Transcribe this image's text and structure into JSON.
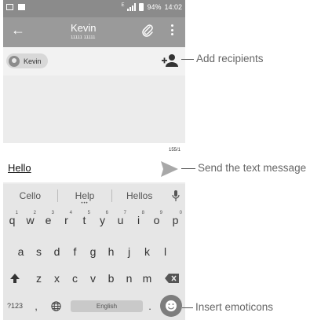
{
  "status_bar": {
    "battery": "94%",
    "time": "14:02",
    "network": "E"
  },
  "app_bar": {
    "contact_name": "Kevin",
    "contact_number": "11111 11111"
  },
  "recipients": {
    "chip_label": "Kevin"
  },
  "compose": {
    "text": "Hello",
    "char_count": "155/1"
  },
  "keyboard": {
    "suggestions": [
      "Cello",
      "Help",
      "Hellos"
    ],
    "row1": [
      {
        "k": "q",
        "n": "1"
      },
      {
        "k": "w",
        "n": "2"
      },
      {
        "k": "e",
        "n": "3"
      },
      {
        "k": "r",
        "n": "4"
      },
      {
        "k": "t",
        "n": "5"
      },
      {
        "k": "y",
        "n": "6"
      },
      {
        "k": "u",
        "n": "7"
      },
      {
        "k": "i",
        "n": "8"
      },
      {
        "k": "o",
        "n": "9"
      },
      {
        "k": "p",
        "n": "0"
      }
    ],
    "row2": [
      "a",
      "s",
      "d",
      "f",
      "g",
      "h",
      "j",
      "k",
      "l"
    ],
    "row3": [
      "z",
      "x",
      "c",
      "v",
      "b",
      "n",
      "m"
    ],
    "symbols_label": "?123",
    "comma": ",",
    "space_label": "English",
    "period": "."
  },
  "callouts": {
    "add_recipients": "Add recipients",
    "send": "Send the text message",
    "emoticons": "Insert emoticons"
  }
}
